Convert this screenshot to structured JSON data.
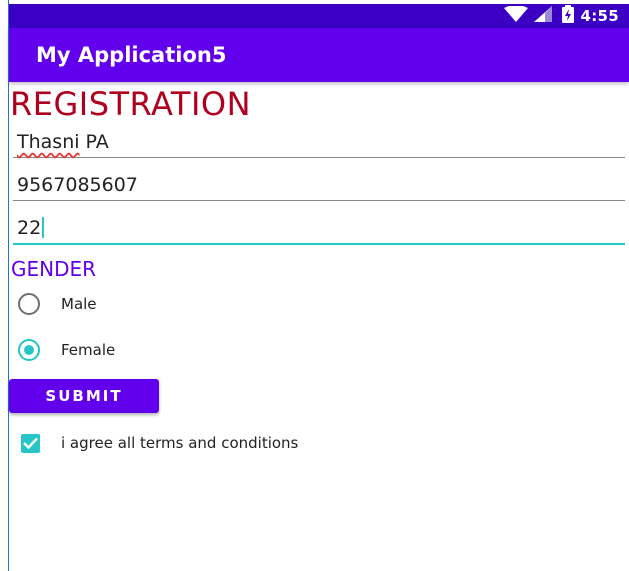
{
  "status_bar": {
    "time": "4:55",
    "icons": [
      "wifi-icon",
      "signal-icon",
      "battery-icon"
    ],
    "background": "#3b00c4"
  },
  "app_bar": {
    "title": "My Application5",
    "background": "#6200ee"
  },
  "form": {
    "title": "REGISTRATION",
    "title_color": "#b0001f",
    "fields": [
      {
        "value": "Thasni PA"
      },
      {
        "value": "9567085607"
      },
      {
        "value": "22",
        "focused": true
      }
    ],
    "gender_label": "GENDER",
    "gender_options": [
      {
        "label": "Male",
        "checked": false
      },
      {
        "label": "Female",
        "checked": true
      }
    ],
    "submit_label": "SUBMIT",
    "terms": {
      "label": "i agree all terms and conditions",
      "checked": true
    }
  },
  "colors": {
    "accent": "#26c6c6",
    "primary": "#6200ee"
  }
}
